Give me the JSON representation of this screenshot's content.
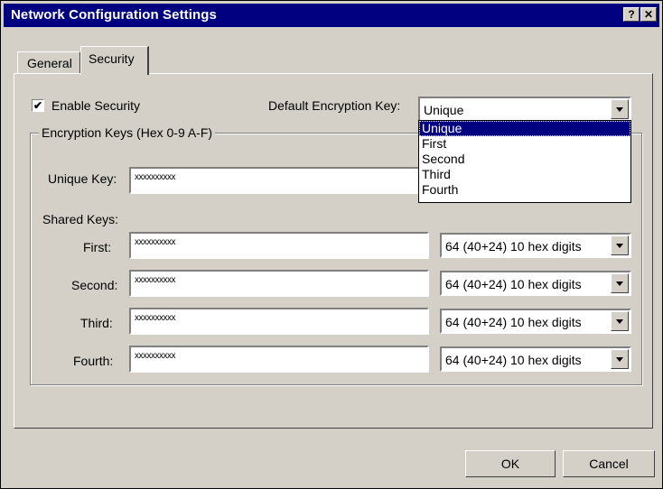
{
  "window": {
    "title": "Network Configuration Settings",
    "help_button": "?",
    "close_button": "✕"
  },
  "tabs": [
    {
      "label": "General"
    },
    {
      "label": "Security"
    }
  ],
  "security": {
    "enable_checkbox": {
      "label": "Enable Security",
      "checked": true,
      "mark": "✔"
    },
    "default_key": {
      "label": "Default Encryption Key:",
      "value": "Unique",
      "options": [
        "Unique",
        "First",
        "Second",
        "Third",
        "Fourth"
      ]
    },
    "group_label": "Encryption Keys (Hex 0-9 A-F)",
    "unique_key": {
      "label": "Unique Key:",
      "value": "xxxxxxxxxx"
    },
    "shared_label": "Shared Keys:",
    "shared_keys": [
      {
        "label": "First:",
        "value": "xxxxxxxxxx",
        "length": "64  (40+24)  10 hex digits"
      },
      {
        "label": "Second:",
        "value": "xxxxxxxxxx",
        "length": "64  (40+24)  10 hex digits"
      },
      {
        "label": "Third:",
        "value": "xxxxxxxxxx",
        "length": "64  (40+24)  10 hex digits"
      },
      {
        "label": "Fourth:",
        "value": "xxxxxxxxxx",
        "length": "64  (40+24)  10 hex digits"
      }
    ]
  },
  "buttons": {
    "ok": "OK",
    "cancel": "Cancel"
  }
}
